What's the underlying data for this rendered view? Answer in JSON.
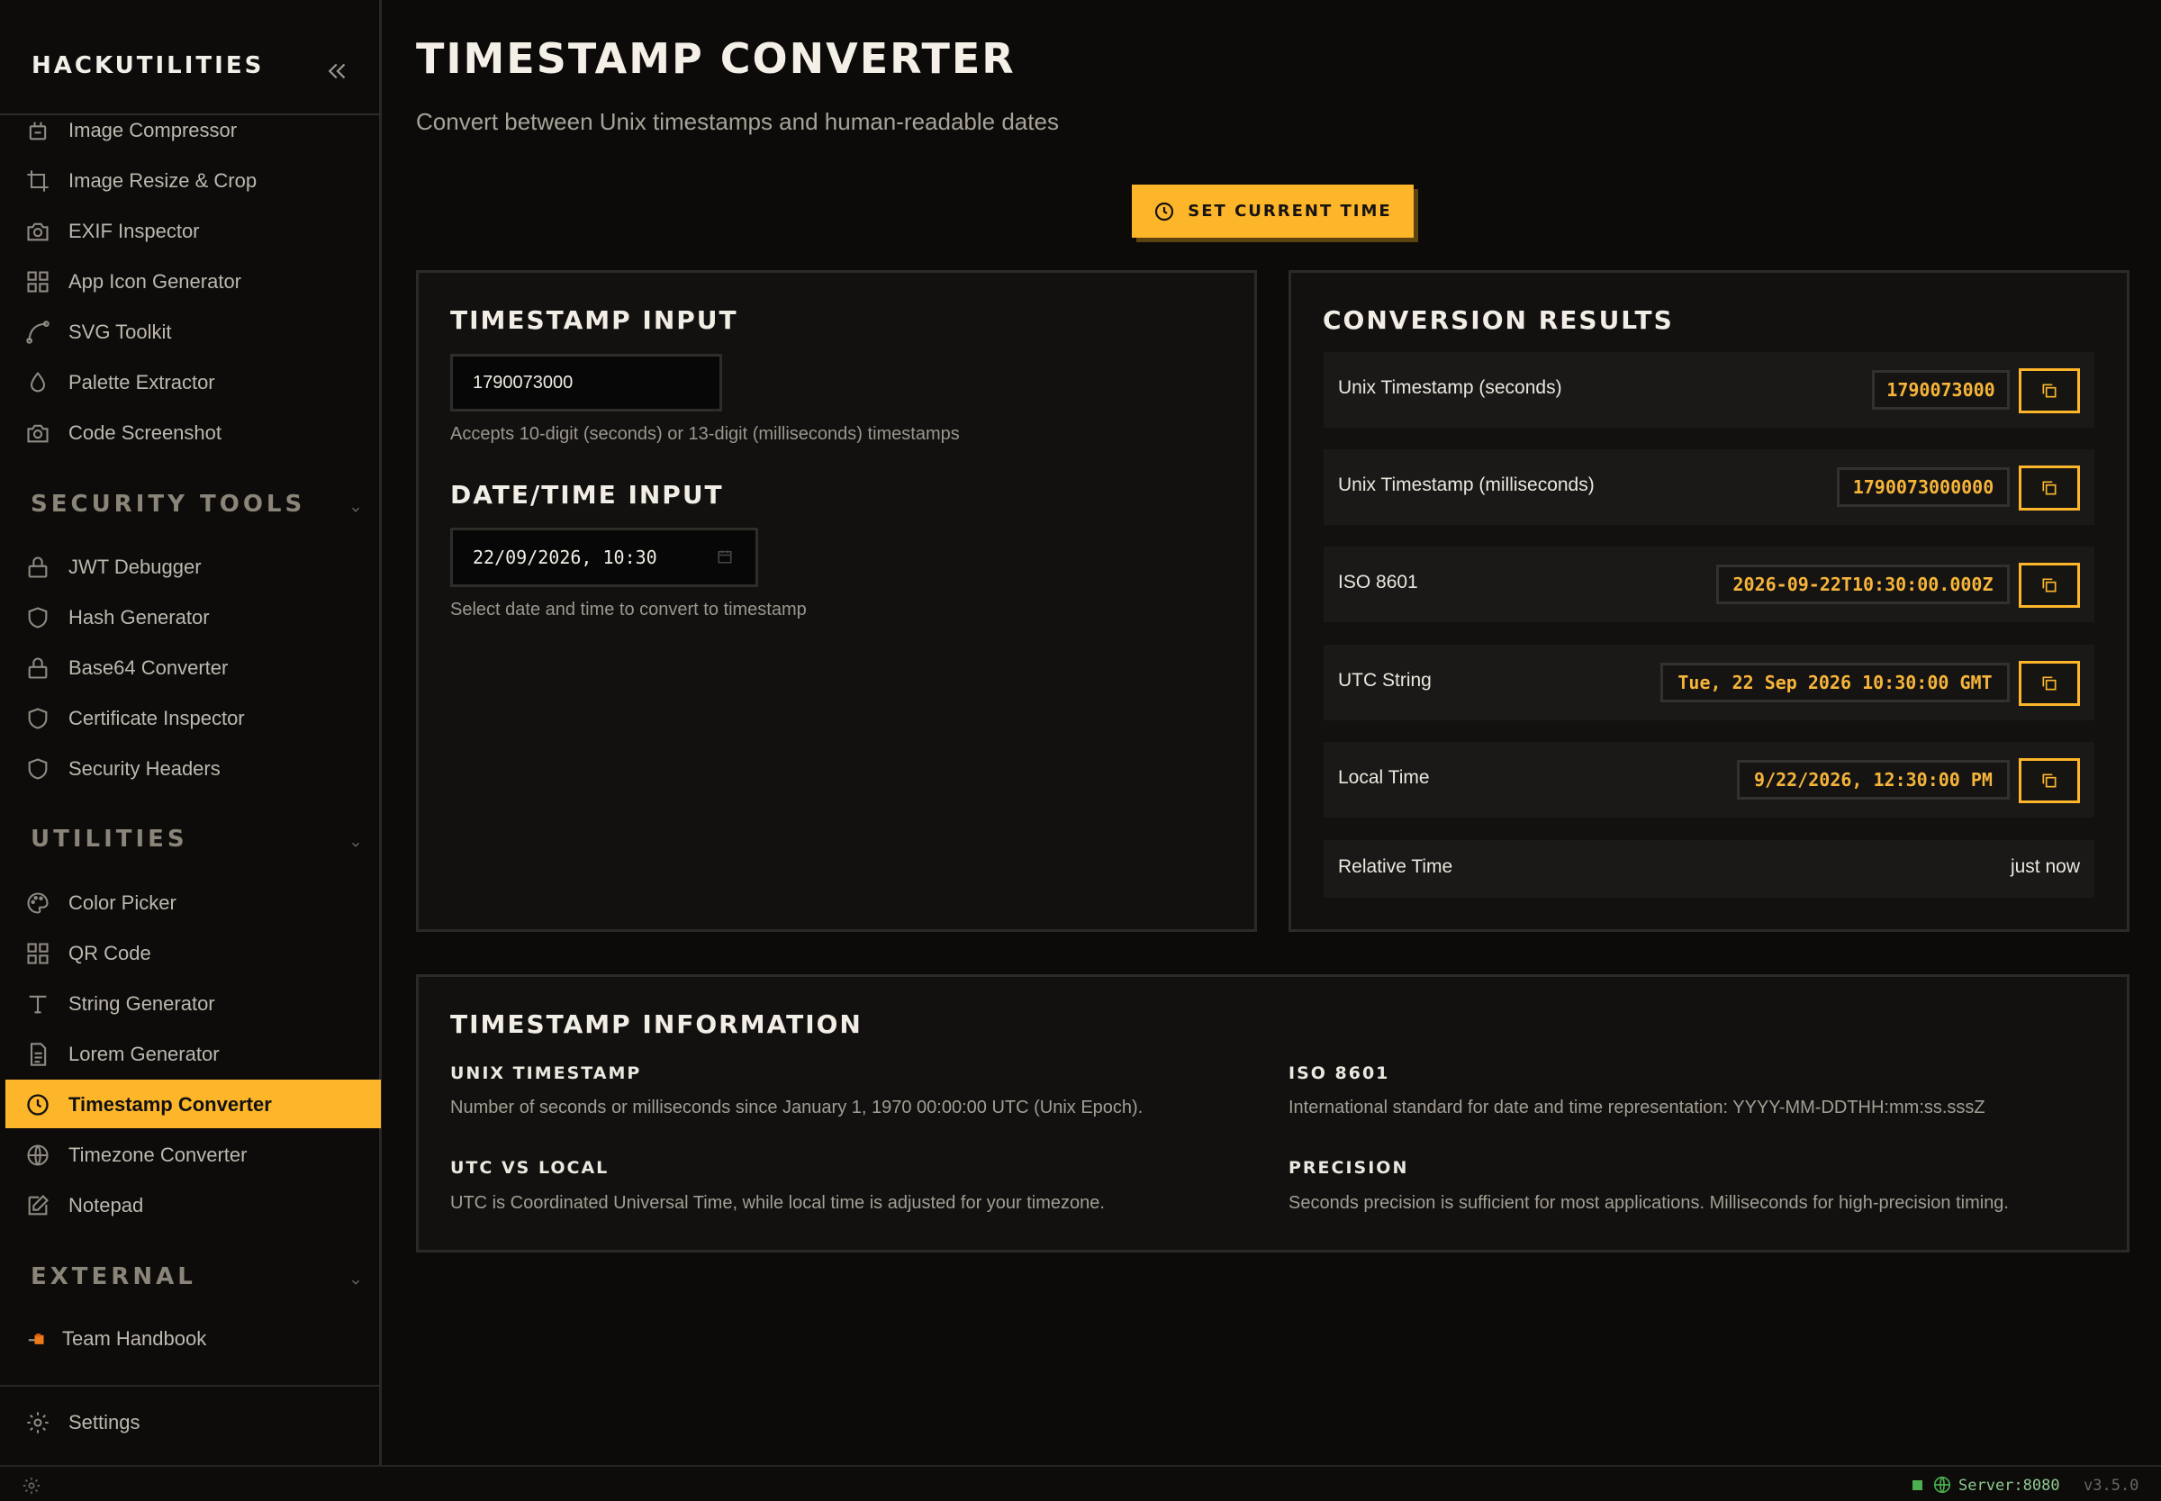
{
  "sidebar": {
    "brand": "HACKUTILITIES",
    "top_items": [
      {
        "label": "Image Compressor",
        "icon": "compress-icon"
      },
      {
        "label": "Image Resize & Crop",
        "icon": "crop-icon"
      },
      {
        "label": "EXIF Inspector",
        "icon": "camera-icon"
      },
      {
        "label": "App Icon Generator",
        "icon": "grid-icon"
      },
      {
        "label": "SVG Toolkit",
        "icon": "bezier-icon"
      },
      {
        "label": "Palette Extractor",
        "icon": "droplet-icon"
      },
      {
        "label": "Code Screenshot",
        "icon": "camera-icon"
      }
    ],
    "security": {
      "title": "SECURITY TOOLS",
      "items": [
        {
          "label": "JWT Debugger",
          "icon": "lock-icon"
        },
        {
          "label": "Hash Generator",
          "icon": "shield-icon"
        },
        {
          "label": "Base64 Converter",
          "icon": "lock-icon"
        },
        {
          "label": "Certificate Inspector",
          "icon": "shield-icon"
        },
        {
          "label": "Security Headers",
          "icon": "shield-icon"
        }
      ]
    },
    "utilities": {
      "title": "UTILITIES",
      "items": [
        {
          "label": "Color Picker",
          "icon": "palette-icon"
        },
        {
          "label": "QR Code",
          "icon": "grid-icon"
        },
        {
          "label": "String Generator",
          "icon": "type-icon"
        },
        {
          "label": "Lorem Generator",
          "icon": "file-text-icon"
        },
        {
          "label": "Timestamp Converter",
          "icon": "clock-icon",
          "active": true
        },
        {
          "label": "Timezone Converter",
          "icon": "globe-icon"
        },
        {
          "label": "Notepad",
          "icon": "edit-icon"
        }
      ]
    },
    "external": {
      "title": "EXTERNAL",
      "items": [
        {
          "label": "Team Handbook",
          "icon": "handbook-icon"
        }
      ]
    },
    "settings_label": "Settings"
  },
  "page": {
    "title": "TIMESTAMP CONVERTER",
    "subtitle": "Convert between Unix timestamps and human-readable dates",
    "set_current_label": "SET CURRENT TIME"
  },
  "input_panel": {
    "timestamp_title": "TIMESTAMP INPUT",
    "timestamp_value": "1790073000",
    "timestamp_hint": "Accepts 10-digit (seconds) or 13-digit (milliseconds) timestamps",
    "datetime_title": "DATE/TIME INPUT",
    "datetime_value": "22/09/2026, 10:30",
    "datetime_hint": "Select date and time to convert to timestamp"
  },
  "results": {
    "title": "CONVERSION RESULTS",
    "rows": [
      {
        "label": "Unix Timestamp (seconds)",
        "value": "1790073000"
      },
      {
        "label": "Unix Timestamp (milliseconds)",
        "value": "1790073000000"
      },
      {
        "label": "ISO 8601",
        "value": "2026-09-22T10:30:00.000Z"
      },
      {
        "label": "UTC String",
        "value": "Tue, 22 Sep 2026 10:30:00 GMT"
      },
      {
        "label": "Local Time",
        "value": "9/22/2026, 12:30:00 PM"
      },
      {
        "label": "Relative Time",
        "value": "just now"
      }
    ]
  },
  "info": {
    "title": "TIMESTAMP INFORMATION",
    "blocks": [
      {
        "heading": "UNIX TIMESTAMP",
        "text": "Number of seconds or milliseconds since January 1, 1970 00:00:00 UTC (Unix Epoch)."
      },
      {
        "heading": "ISO 8601",
        "text": "International standard for date and time representation: YYYY-MM-DDTHH:mm:ss.sssZ"
      },
      {
        "heading": "UTC VS LOCAL",
        "text": "UTC is Coordinated Universal Time, while local time is adjusted for your timezone."
      },
      {
        "heading": "PRECISION",
        "text": "Seconds precision is sufficient for most applications. Milliseconds for high-precision timing."
      }
    ]
  },
  "footer": {
    "server": "Server:8080",
    "version": "v3.5.0"
  },
  "colors": {
    "accent": "#fdb52a",
    "background": "#0c0b0a",
    "panel": "#121110",
    "status_green": "#4caf50"
  }
}
